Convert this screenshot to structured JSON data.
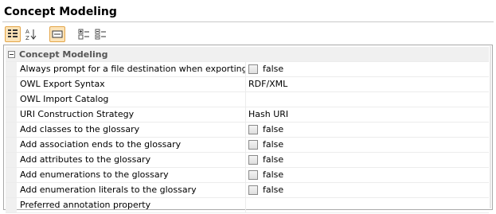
{
  "window": {
    "title": "Concept Modeling"
  },
  "toolbar": {
    "buttons": [
      {
        "icon": "categorized-view-icon",
        "active": true
      },
      {
        "icon": "sort-alphabetical-icon",
        "active": false
      },
      {
        "icon": "show-description-icon",
        "active": true
      },
      {
        "icon": "expand-all-icon",
        "active": false
      },
      {
        "icon": "collapse-all-icon",
        "active": false
      }
    ]
  },
  "group": {
    "label": "Concept Modeling"
  },
  "properties": [
    {
      "name": "Always prompt for a file destination when exporting OWL",
      "value": "false",
      "checkbox": true
    },
    {
      "name": "OWL Export Syntax",
      "value": "RDF/XML",
      "checkbox": false
    },
    {
      "name": "OWL Import Catalog",
      "value": "",
      "checkbox": false
    },
    {
      "name": "URI Construction Strategy",
      "value": "Hash URI",
      "checkbox": false
    },
    {
      "name": "Add classes to the glossary",
      "value": "false",
      "checkbox": true
    },
    {
      "name": "Add association ends to the glossary",
      "value": "false",
      "checkbox": true
    },
    {
      "name": "Add attributes to the glossary",
      "value": "false",
      "checkbox": true
    },
    {
      "name": "Add enumerations to the glossary",
      "value": "false",
      "checkbox": true
    },
    {
      "name": "Add enumeration literals to the glossary",
      "value": "false",
      "checkbox": true
    },
    {
      "name": "Preferred annotation property",
      "value": "",
      "checkbox": false
    }
  ]
}
